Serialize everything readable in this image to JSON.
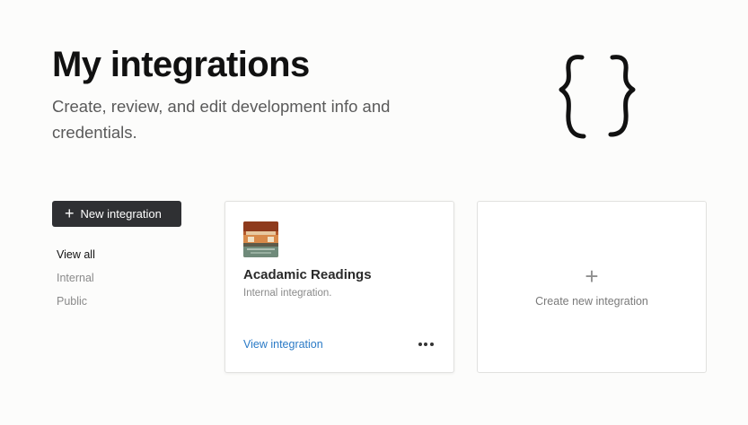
{
  "header": {
    "title": "My integrations",
    "subtitle": "Create, review, and edit development info and credentials."
  },
  "actions": {
    "new_integration_icon": "+",
    "new_integration_label": "New integration"
  },
  "filters": [
    {
      "label": "View all",
      "active": true
    },
    {
      "label": "Internal",
      "active": false
    },
    {
      "label": "Public",
      "active": false
    }
  ],
  "integrations": [
    {
      "name": "Acadamic Readings",
      "description": "Internal integration.",
      "link_label": "View integration",
      "more_icon": "ellipsis-icon"
    }
  ],
  "create_card": {
    "icon": "+",
    "label": "Create new integration"
  },
  "colors": {
    "button_bg": "#2f3033",
    "link": "#2a7ac6",
    "page_bg": "#fcfcfb"
  }
}
